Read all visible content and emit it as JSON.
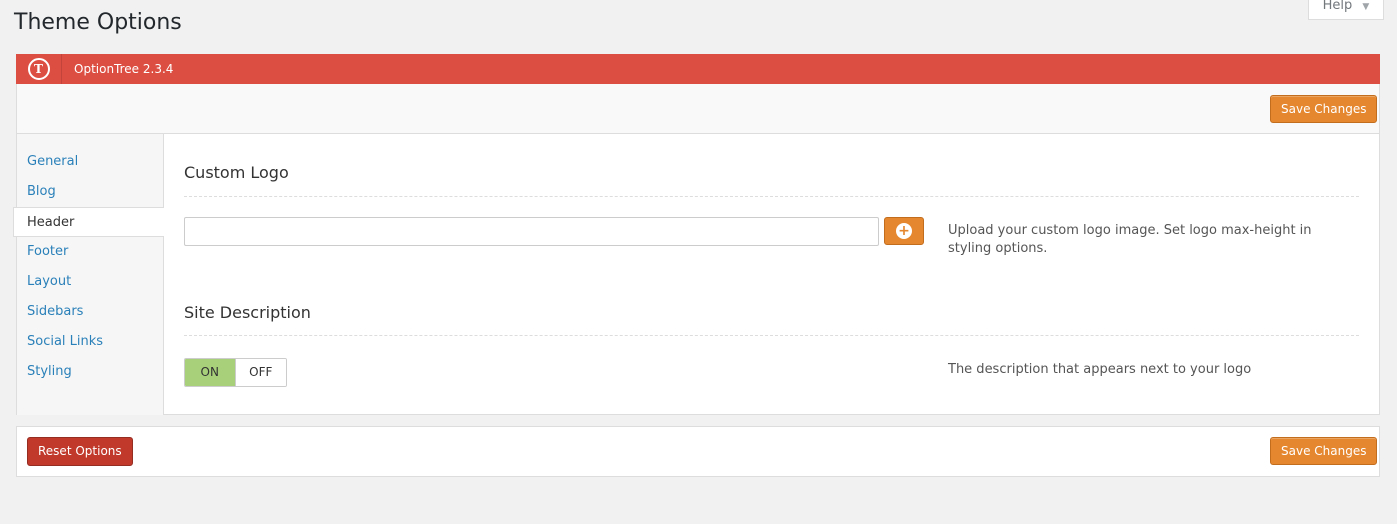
{
  "page": {
    "title": "Theme Options",
    "help_label": "Help",
    "help_arrow": "▼"
  },
  "optiontree": {
    "logo_glyph": "T",
    "version_label": "OptionTree 2.3.4",
    "save_label": "Save Changes",
    "reset_label": "Reset Options"
  },
  "sidebar": {
    "items": [
      {
        "label": "General",
        "active": false
      },
      {
        "label": "Blog",
        "active": false
      },
      {
        "label": "Header",
        "active": true
      },
      {
        "label": "Footer",
        "active": false
      },
      {
        "label": "Layout",
        "active": false
      },
      {
        "label": "Sidebars",
        "active": false
      },
      {
        "label": "Social Links",
        "active": false
      },
      {
        "label": "Styling",
        "active": false
      }
    ]
  },
  "fields": {
    "custom_logo": {
      "title": "Custom Logo",
      "value": "",
      "description": "Upload your custom logo image. Set logo max-height in styling options."
    },
    "site_description": {
      "title": "Site Description",
      "on_label": "ON",
      "off_label": "OFF",
      "selected": "ON",
      "description": "The description that appears next to your logo"
    }
  },
  "colors": {
    "header_red": "#dd4e42",
    "save_orange": "#e5872f",
    "reset_red": "#c0392b",
    "toggle_on_green": "#a8d07b",
    "link_blue": "#2a80b9"
  }
}
